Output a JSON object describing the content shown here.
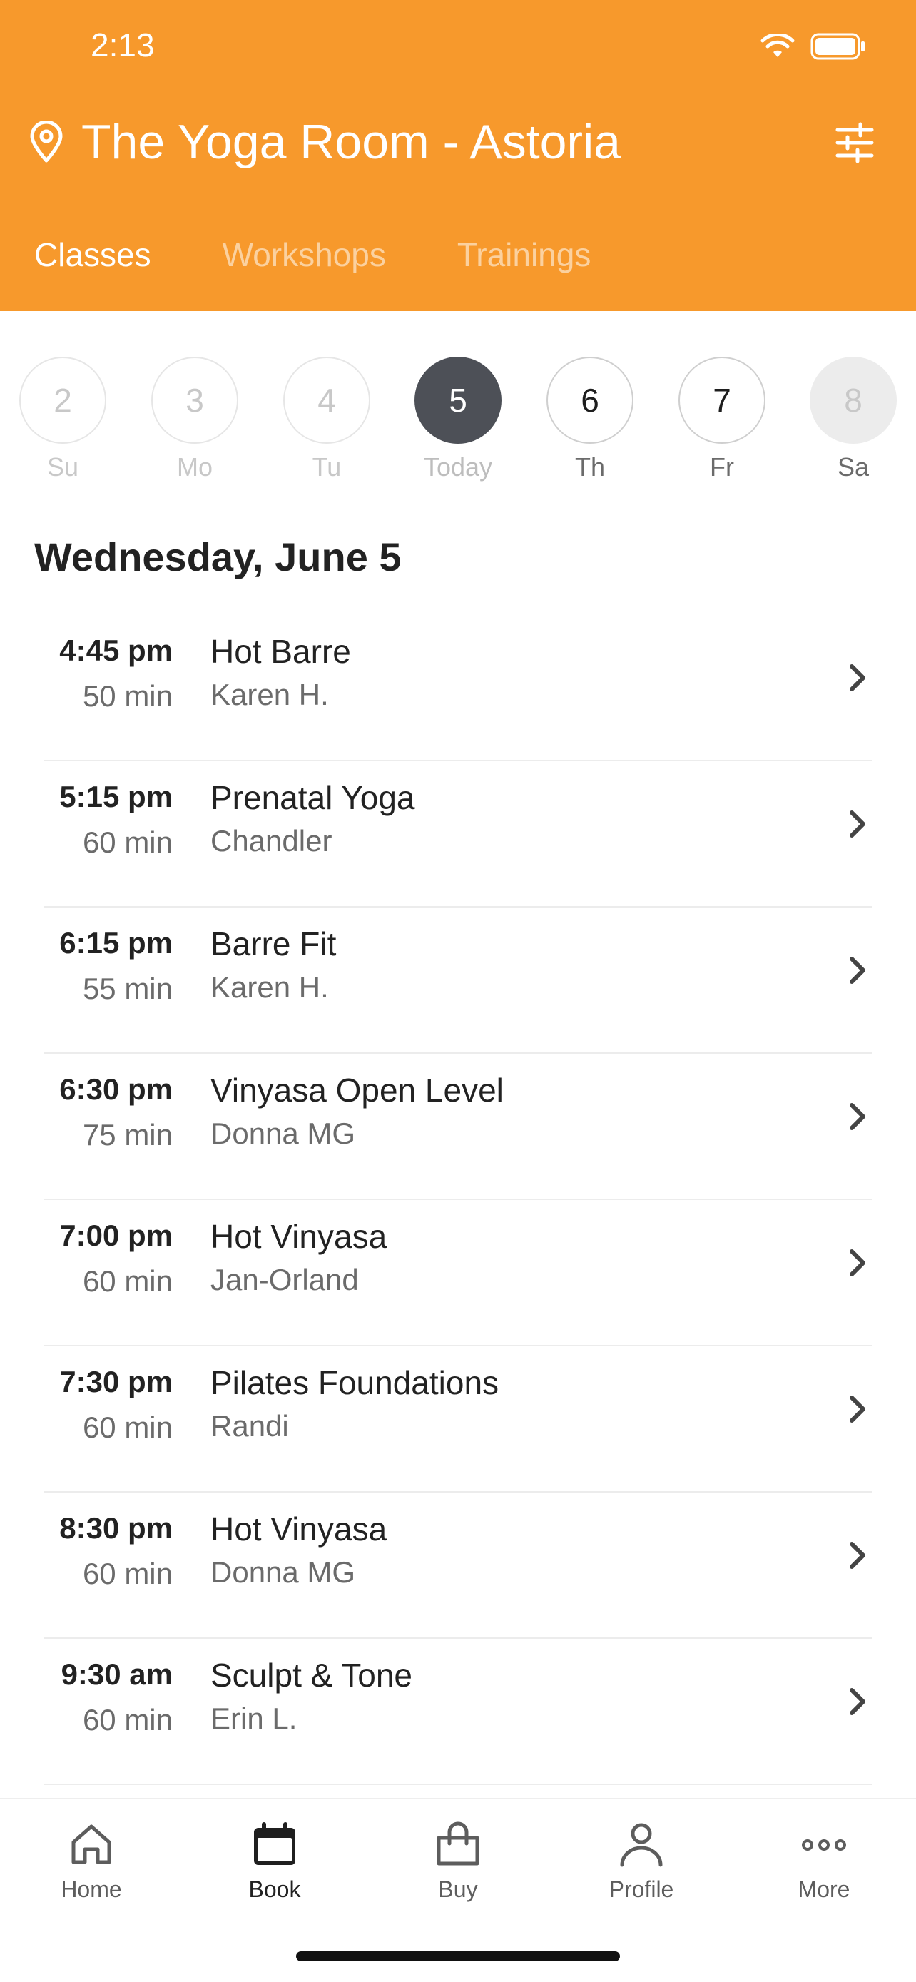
{
  "status": {
    "time": "2:13"
  },
  "header": {
    "studio_name": "The Yoga Room - Astoria",
    "tabs": [
      {
        "label": "Classes",
        "active": true
      },
      {
        "label": "Workshops",
        "active": false
      },
      {
        "label": "Trainings",
        "active": false
      }
    ]
  },
  "days": [
    {
      "num": "2",
      "label": "Su",
      "state": "past"
    },
    {
      "num": "3",
      "label": "Mo",
      "state": "past"
    },
    {
      "num": "4",
      "label": "Tu",
      "state": "past"
    },
    {
      "num": "5",
      "label": "Today",
      "state": "today"
    },
    {
      "num": "6",
      "label": "Th",
      "state": "future"
    },
    {
      "num": "7",
      "label": "Fr",
      "state": "future"
    },
    {
      "num": "8",
      "label": "Sa",
      "state": "off"
    }
  ],
  "date_heading": "Wednesday, June 5",
  "classes": [
    {
      "time": "4:45 pm",
      "duration": "50 min",
      "name": "Hot Barre",
      "teacher": "Karen H."
    },
    {
      "time": "5:15 pm",
      "duration": "60 min",
      "name": "Prenatal Yoga",
      "teacher": "Chandler"
    },
    {
      "time": "6:15 pm",
      "duration": "55 min",
      "name": "Barre Fit",
      "teacher": "Karen H."
    },
    {
      "time": "6:30 pm",
      "duration": "75 min",
      "name": "Vinyasa Open Level",
      "teacher": "Donna MG"
    },
    {
      "time": "7:00 pm",
      "duration": "60 min",
      "name": "Hot Vinyasa",
      "teacher": "Jan-Orland"
    },
    {
      "time": "7:30 pm",
      "duration": "60 min",
      "name": "Pilates Foundations",
      "teacher": "Randi"
    },
    {
      "time": "8:30 pm",
      "duration": "60 min",
      "name": "Hot Vinyasa",
      "teacher": "Donna MG"
    },
    {
      "time": "9:30 am",
      "duration": "60 min",
      "name": "Sculpt & Tone",
      "teacher": "Erin L."
    }
  ],
  "nav": [
    {
      "label": "Home",
      "icon": "home-icon",
      "active": false
    },
    {
      "label": "Book",
      "icon": "calendar-icon",
      "active": true
    },
    {
      "label": "Buy",
      "icon": "shopping-bag-icon",
      "active": false
    },
    {
      "label": "Profile",
      "icon": "person-icon",
      "active": false
    },
    {
      "label": "More",
      "icon": "more-dots-icon",
      "active": false
    }
  ],
  "colors": {
    "brand": "#f7992c",
    "today": "#4d5057"
  }
}
